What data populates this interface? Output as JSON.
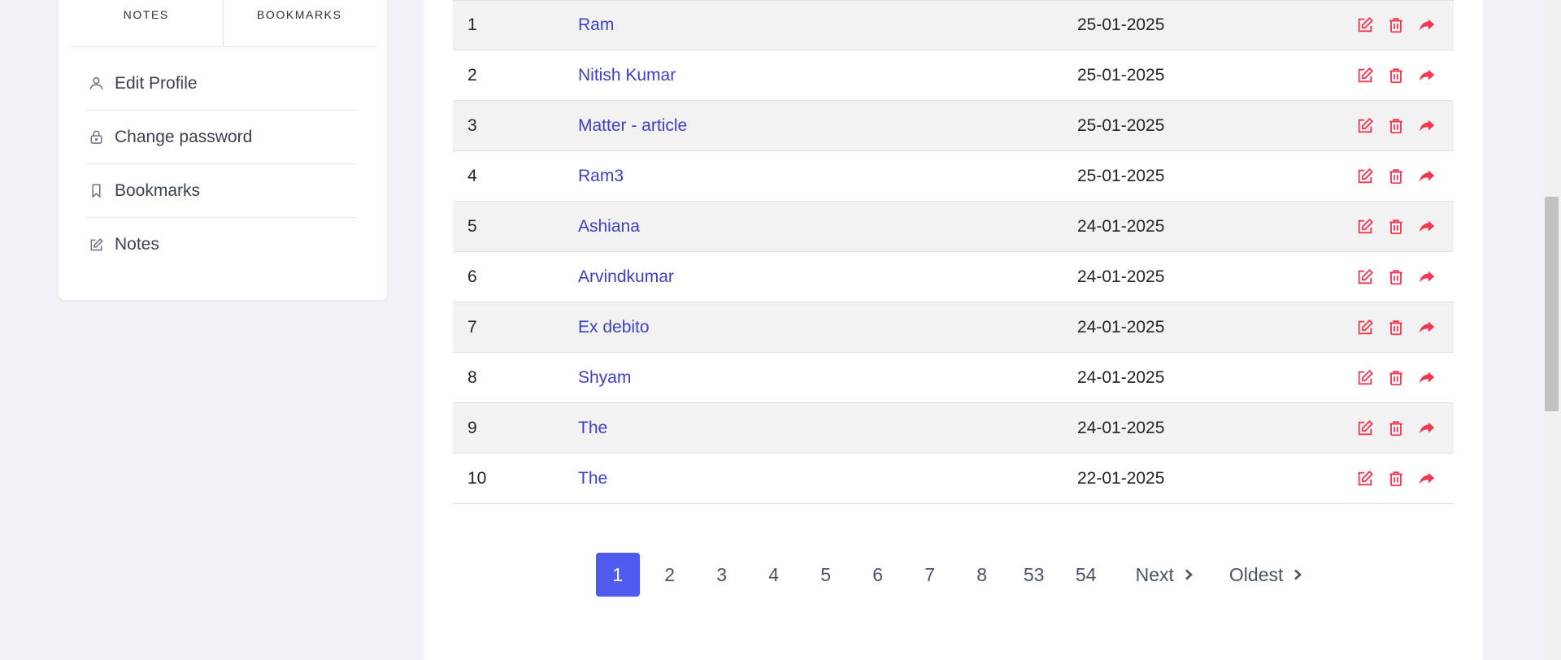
{
  "sidebar": {
    "tabs": [
      {
        "label": "NOTES"
      },
      {
        "label": "BOOKMARKS"
      }
    ],
    "items": [
      {
        "label": "Edit Profile",
        "icon": "user-icon"
      },
      {
        "label": "Change password",
        "icon": "lock-icon"
      },
      {
        "label": "Bookmarks",
        "icon": "bookmark-icon"
      },
      {
        "label": "Notes",
        "icon": "edit-note-icon"
      }
    ]
  },
  "table": {
    "rows": [
      {
        "index": "1",
        "title": "Ram",
        "date": "25-01-2025"
      },
      {
        "index": "2",
        "title": "Nitish Kumar",
        "date": "25-01-2025"
      },
      {
        "index": "3",
        "title": "Matter - article",
        "date": "25-01-2025"
      },
      {
        "index": "4",
        "title": "Ram3",
        "date": "25-01-2025"
      },
      {
        "index": "5",
        "title": "Ashiana",
        "date": "24-01-2025"
      },
      {
        "index": "6",
        "title": "Arvindkumar",
        "date": "24-01-2025"
      },
      {
        "index": "7",
        "title": "Ex debito",
        "date": "24-01-2025"
      },
      {
        "index": "8",
        "title": "Shyam",
        "date": "24-01-2025"
      },
      {
        "index": "9",
        "title": "The",
        "date": "24-01-2025"
      },
      {
        "index": "10",
        "title": "The",
        "date": "22-01-2025"
      }
    ],
    "action_icons": [
      "edit-icon",
      "trash-icon",
      "share-icon"
    ]
  },
  "pagination": {
    "current": "1",
    "pages": [
      "1",
      "2",
      "3",
      "4",
      "5",
      "6",
      "7",
      "8",
      "53",
      "54"
    ],
    "next_label": "Next",
    "oldest_label": "Oldest"
  },
  "colors": {
    "accent": "#4e5bec",
    "link": "#3d3fc6",
    "action": "#f0384f",
    "background": "#eff2f7"
  }
}
